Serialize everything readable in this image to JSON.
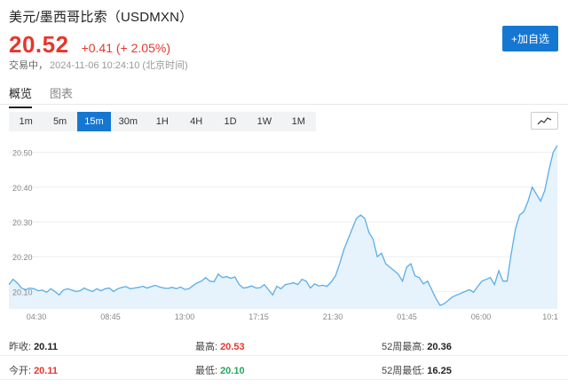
{
  "header": {
    "title": "美元/墨西哥比索（USDMXN）",
    "price": "20.52",
    "change": "+0.41 (+ 2.05%)",
    "status": "交易中",
    "timestamp": "2024-11-06 10:24:10 (北京时间)",
    "add_button": "+加自选"
  },
  "tabs": [
    "概览",
    "图表"
  ],
  "periods": [
    "1m",
    "5m",
    "15m",
    "30m",
    "1H",
    "4H",
    "1D",
    "1W",
    "1M"
  ],
  "active_period": "15m",
  "colors": {
    "up": "#e6372c",
    "down": "#27a560",
    "accent": "#1677d2",
    "line": "#5aaee8",
    "area": "#e6f2fc"
  },
  "stats": {
    "prev_close_label": "昨收:",
    "prev_close": "20.11",
    "open_label": "今开:",
    "open": "20.11",
    "high_label": "最高:",
    "high": "20.53",
    "low_label": "最低:",
    "low": "20.10",
    "w52_high_label": "52周最高:",
    "w52_high": "20.36",
    "w52_low_label": "52周最低:",
    "w52_low": "16.25"
  },
  "chart_data": {
    "type": "area",
    "y_ticks": [
      "20.50",
      "20.40",
      "20.30",
      "20.20",
      "20.10"
    ],
    "x_ticks": [
      "04:30",
      "08:45",
      "13:00",
      "17:15",
      "21:30",
      "01:45",
      "06:00",
      "10:1"
    ],
    "ylim": [
      20.05,
      20.54
    ],
    "grid": true,
    "values": [
      20.12,
      20.135,
      20.125,
      20.11,
      20.105,
      20.11,
      20.108,
      20.102,
      20.104,
      20.098,
      20.108,
      20.1,
      20.09,
      20.104,
      20.108,
      20.104,
      20.1,
      20.102,
      20.11,
      20.104,
      20.1,
      20.108,
      20.102,
      20.108,
      20.11,
      20.1,
      20.108,
      20.112,
      20.114,
      20.108,
      20.11,
      20.112,
      20.115,
      20.11,
      20.114,
      20.118,
      20.113,
      20.11,
      20.109,
      20.112,
      20.108,
      20.113,
      20.106,
      20.108,
      20.117,
      20.125,
      20.13,
      20.14,
      20.13,
      20.128,
      20.15,
      20.14,
      20.143,
      20.138,
      20.142,
      20.12,
      20.11,
      20.112,
      20.116,
      20.11,
      20.111,
      20.12,
      20.105,
      20.09,
      20.115,
      20.108,
      20.12,
      20.122,
      20.125,
      20.12,
      20.135,
      20.13,
      20.11,
      20.122,
      20.116,
      20.118,
      20.115,
      20.128,
      20.145,
      20.18,
      20.22,
      20.25,
      20.28,
      20.31,
      20.32,
      20.31,
      20.27,
      20.25,
      20.2,
      20.21,
      20.18,
      20.17,
      20.16,
      20.15,
      20.13,
      20.17,
      20.18,
      20.145,
      20.14,
      20.122,
      20.13,
      20.105,
      20.08,
      20.06,
      20.065,
      20.075,
      20.085,
      20.09,
      20.095,
      20.1,
      20.105,
      20.098,
      20.115,
      20.13,
      20.135,
      20.14,
      20.12,
      20.16,
      20.13,
      20.13,
      20.21,
      20.28,
      20.32,
      20.33,
      20.36,
      20.4,
      20.38,
      20.36,
      20.39,
      20.45,
      20.5,
      20.52
    ]
  }
}
